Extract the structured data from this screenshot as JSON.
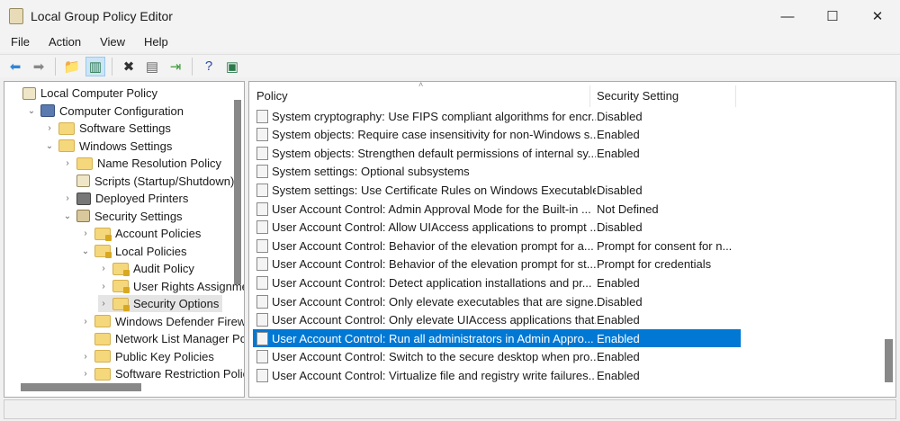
{
  "window": {
    "title": "Local Group Policy Editor",
    "minimize": "—",
    "maximize": "☐",
    "close": "✕"
  },
  "menu": [
    "File",
    "Action",
    "View",
    "Help"
  ],
  "toolbar": [
    {
      "icon": "back-arrow-icon",
      "glyph": "⬅",
      "color": "#2f86d4"
    },
    {
      "icon": "forward-arrow-icon",
      "glyph": "➡",
      "color": "#888888"
    },
    {
      "icon": "up-folder-icon",
      "glyph": "📁",
      "color": "#d4a020"
    },
    {
      "icon": "show-hide-tree-icon",
      "glyph": "▥",
      "color": "#2a7a4a"
    },
    {
      "icon": "delete-icon",
      "glyph": "✖",
      "color": "#333333"
    },
    {
      "icon": "properties-icon",
      "glyph": "▤",
      "color": "#666666"
    },
    {
      "icon": "export-list-icon",
      "glyph": "⇥",
      "color": "#3a9a3a"
    },
    {
      "icon": "help-icon",
      "glyph": "?",
      "color": "#2a4aa8"
    },
    {
      "icon": "show-action-pane-icon",
      "glyph": "▣",
      "color": "#2a7a4a"
    }
  ],
  "tree": [
    {
      "label": "Local Computer Policy",
      "level": 0,
      "chev": "",
      "icon": "doc"
    },
    {
      "label": "Computer Configuration",
      "level": 1,
      "chev": "⌄",
      "icon": "pc"
    },
    {
      "label": "Software Settings",
      "level": 2,
      "chev": "›",
      "icon": "folder"
    },
    {
      "label": "Windows Settings",
      "level": 2,
      "chev": "⌄",
      "icon": "folder"
    },
    {
      "label": "Name Resolution Policy",
      "level": 3,
      "chev": "›",
      "icon": "folder"
    },
    {
      "label": "Scripts (Startup/Shutdown)",
      "level": 3,
      "chev": "",
      "icon": "doc"
    },
    {
      "label": "Deployed Printers",
      "level": 3,
      "chev": "›",
      "icon": "print"
    },
    {
      "label": "Security Settings",
      "level": 3,
      "chev": "⌄",
      "icon": "sec"
    },
    {
      "label": "Account Policies",
      "level": 4,
      "chev": "›",
      "icon": "lock"
    },
    {
      "label": "Local Policies",
      "level": 4,
      "chev": "⌄",
      "icon": "lock"
    },
    {
      "label": "Audit Policy",
      "level": 5,
      "chev": "›",
      "icon": "lock"
    },
    {
      "label": "User Rights Assignme",
      "level": 5,
      "chev": "›",
      "icon": "lock"
    },
    {
      "label": "Security Options",
      "level": 5,
      "chev": "›",
      "icon": "lock",
      "selected": true
    },
    {
      "label": "Windows Defender Firew",
      "level": 4,
      "chev": "›",
      "icon": "folder"
    },
    {
      "label": "Network List Manager Po",
      "level": 4,
      "chev": "",
      "icon": "folder"
    },
    {
      "label": "Public Key Policies",
      "level": 4,
      "chev": "›",
      "icon": "folder"
    },
    {
      "label": "Software Restriction Polic",
      "level": 4,
      "chev": "›",
      "icon": "folder"
    }
  ],
  "list": {
    "columns": [
      "Policy",
      "Security Setting"
    ],
    "rows": [
      {
        "policy": "System cryptography: Use FIPS compliant algorithms for encr...",
        "setting": "Disabled"
      },
      {
        "policy": "System objects: Require case insensitivity for non-Windows s...",
        "setting": "Enabled"
      },
      {
        "policy": "System objects: Strengthen default permissions of internal sy...",
        "setting": "Enabled"
      },
      {
        "policy": "System settings: Optional subsystems",
        "setting": ""
      },
      {
        "policy": "System settings: Use Certificate Rules on Windows Executable...",
        "setting": "Disabled"
      },
      {
        "policy": "User Account Control: Admin Approval Mode for the Built-in ...",
        "setting": "Not Defined"
      },
      {
        "policy": "User Account Control: Allow UIAccess applications to prompt ...",
        "setting": "Disabled"
      },
      {
        "policy": "User Account Control: Behavior of the elevation prompt for a...",
        "setting": "Prompt for consent for n..."
      },
      {
        "policy": "User Account Control: Behavior of the elevation prompt for st...",
        "setting": "Prompt for credentials"
      },
      {
        "policy": "User Account Control: Detect application installations and pr...",
        "setting": "Enabled"
      },
      {
        "policy": "User Account Control: Only elevate executables that are signe...",
        "setting": "Disabled"
      },
      {
        "policy": "User Account Control: Only elevate UIAccess applications that...",
        "setting": "Enabled"
      },
      {
        "policy": "User Account Control: Run all administrators in Admin Appro...",
        "setting": "Enabled",
        "selected": true
      },
      {
        "policy": "User Account Control: Switch to the secure desktop when pro...",
        "setting": "Enabled"
      },
      {
        "policy": "User Account Control: Virtualize file and registry write failures...",
        "setting": "Enabled"
      }
    ]
  },
  "selection_color": "#0078d4"
}
